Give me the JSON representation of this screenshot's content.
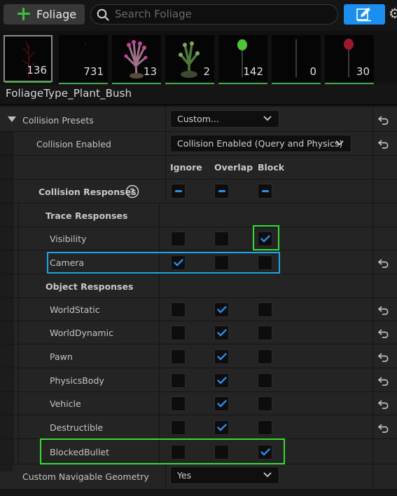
{
  "toolbar": {
    "add_label": "Foliage",
    "search_placeholder": "Search Foliage"
  },
  "thumbnails": [
    {
      "count": "136",
      "selected": true
    },
    {
      "count": "731"
    },
    {
      "count": "13"
    },
    {
      "count": "2"
    },
    {
      "count": "142"
    },
    {
      "count": "0"
    },
    {
      "count": "30"
    }
  ],
  "details": {
    "foliage_type_name": "FoliageType_Plant_Bush",
    "collision_presets_label": "Collision Presets",
    "collision_presets_value": "Custom...",
    "collision_enabled_label": "Collision Enabled",
    "collision_enabled_value": "Collision Enabled (Query and Physics)",
    "col_ignore": "Ignore",
    "col_overlap": "Overlap",
    "col_block": "Block",
    "collision_responses_label": "Collision Responses",
    "trace_responses_label": "Trace Responses",
    "object_responses_label": "Object Responses",
    "rows": [
      {
        "label": "Visibility",
        "state": "block"
      },
      {
        "label": "Camera",
        "state": "ignore"
      },
      {
        "label": "WorldStatic",
        "state": "overlap"
      },
      {
        "label": "WorldDynamic",
        "state": "overlap"
      },
      {
        "label": "Pawn",
        "state": "overlap"
      },
      {
        "label": "PhysicsBody",
        "state": "overlap"
      },
      {
        "label": "Vehicle",
        "state": "overlap"
      },
      {
        "label": "Destructible",
        "state": "overlap"
      },
      {
        "label": "BlockedBullet",
        "state": "block"
      }
    ],
    "custom_nav_label": "Custom Navigable Geometry",
    "custom_nav_value": "Yes"
  },
  "colors": {
    "accent_blue": "#1b8ef0",
    "check_blue": "#2b8fe8",
    "highlight_green": "#33dd33",
    "highlight_blue": "#1da7e6",
    "plus_green": "#3fbf3f"
  }
}
